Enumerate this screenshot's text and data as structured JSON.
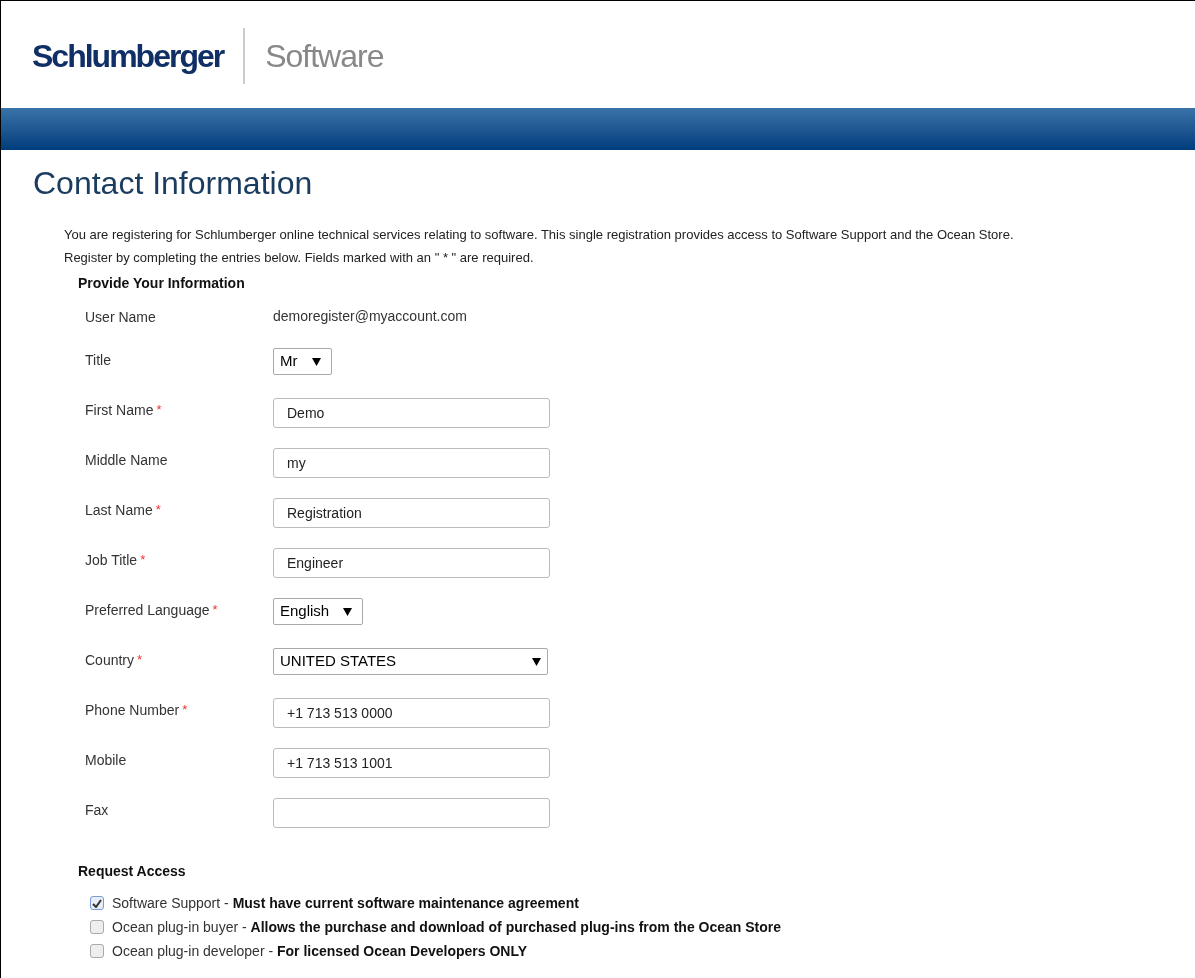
{
  "header": {
    "brand": "Schlumberger",
    "product": "Software"
  },
  "page_title": "Contact Information",
  "intro": [
    "You are registering for Schlumberger online technical services relating to software. This single registration provides access to Software Support and the Ocean Store.",
    "Register by completing the entries below. Fields marked with an \" * \" are required."
  ],
  "section_info": {
    "title": "Provide Your Information",
    "required_mark": "*",
    "fields": [
      {
        "kind": "static",
        "label": "User Name",
        "required": false,
        "value": "demoregister@myaccount.com"
      },
      {
        "kind": "select",
        "label": "Title",
        "required": false,
        "value": "Mr"
      },
      {
        "kind": "text",
        "label": "First Name",
        "required": true,
        "value": "Demo"
      },
      {
        "kind": "text",
        "label": "Middle Name",
        "required": false,
        "value": "my"
      },
      {
        "kind": "text",
        "label": "Last Name",
        "required": true,
        "value": "Registration"
      },
      {
        "kind": "text",
        "label": "Job Title",
        "required": true,
        "value": "Engineer"
      },
      {
        "kind": "select",
        "label": "Preferred Language",
        "required": true,
        "value": "English"
      },
      {
        "kind": "wide_select",
        "label": "Country",
        "required": true,
        "value": "UNITED STATES"
      },
      {
        "kind": "text",
        "label": "Phone Number",
        "required": true,
        "value": "+1 713 513 0000"
      },
      {
        "kind": "text",
        "label": "Mobile",
        "required": false,
        "value": "+1 713 513 1001"
      },
      {
        "kind": "text",
        "label": "Fax",
        "required": false
      }
    ]
  },
  "section_access": {
    "title": "Request Access",
    "options": [
      {
        "text": "Software Support - **Must have current software maintenance agreement**",
        "checked": true
      },
      {
        "text": "Ocean plug-in buyer - **Allows the purchase and download of purchased plug-ins from the Ocean Store**",
        "checked": false
      },
      {
        "text": "Ocean plug-in developer - **For licensed Ocean Developers ONLY**",
        "checked": false
      }
    ]
  }
}
